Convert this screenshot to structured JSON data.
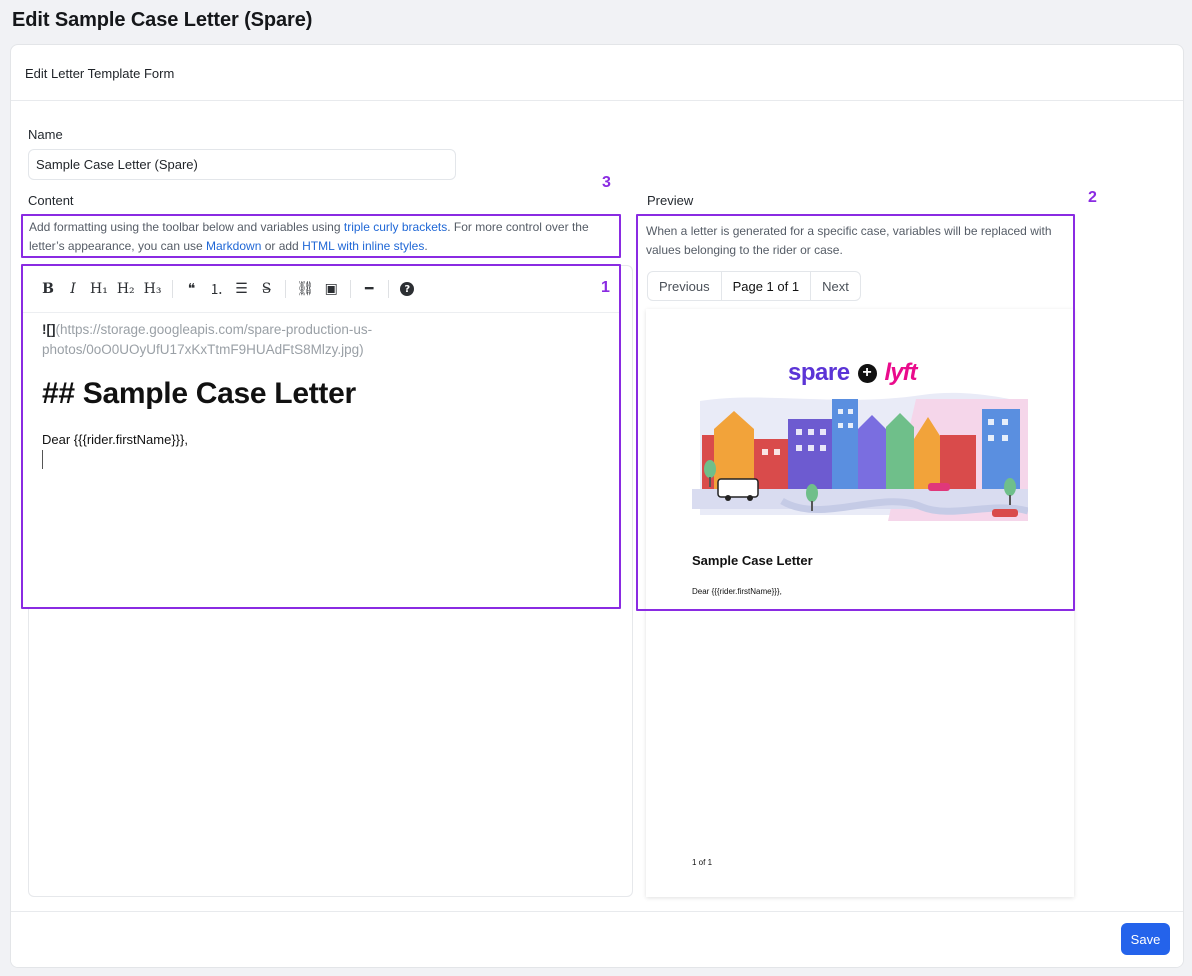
{
  "page": {
    "title": "Edit Sample Case Letter (Spare)"
  },
  "form": {
    "header": "Edit Letter Template Form",
    "name_label": "Name",
    "name_value": "Sample Case Letter (Spare)",
    "content_label": "Content",
    "content_help": {
      "part1": "Add formatting using the toolbar below and variables using ",
      "link1": "triple curly brackets",
      "part2": ". For more control over the letter’s appearance, you can use ",
      "link2": "Markdown",
      "part3": "  or add ",
      "link3": "HTML with inline styles",
      "part4": "."
    },
    "preview_label": "Preview",
    "preview_help": "When a letter is generated for a specific case, variables will be replaced with values belonging to the rider or case.",
    "annotations": {
      "editor": "1",
      "preview": "2",
      "help": "3"
    },
    "toolbar": [
      {
        "name": "bold-icon",
        "glyph": "B"
      },
      {
        "name": "italic-icon",
        "glyph": "I"
      },
      {
        "name": "heading-1-icon",
        "glyph": "H₁"
      },
      {
        "name": "heading-2-icon",
        "glyph": "H₂"
      },
      {
        "name": "heading-3-icon",
        "glyph": "H₃"
      },
      {
        "name": "quote-icon",
        "glyph": "❝"
      },
      {
        "name": "ordered-list-icon",
        "glyph": "⒈"
      },
      {
        "name": "unordered-list-icon",
        "glyph": "☰"
      },
      {
        "name": "strikethrough-icon",
        "glyph": "S̶"
      },
      {
        "name": "link-icon",
        "glyph": "⛓"
      },
      {
        "name": "image-icon",
        "glyph": "▣"
      },
      {
        "name": "horizontal-rule-icon",
        "glyph": "━"
      },
      {
        "name": "help-icon",
        "glyph": "?"
      }
    ],
    "editor": {
      "image_markdown_bang": "![]",
      "image_markdown_url": "(https://storage.googleapis.com/spare-production-us-photos/0oO0UOyUfU17xKxTtmF9HUAdFtS8Mlzy.jpg)",
      "heading": "## Sample Case Letter",
      "paragraph": "Dear {{{rider.firstName}}},"
    },
    "pager": {
      "previous": "Previous",
      "info": "Page 1 of 1",
      "next": "Next"
    },
    "preview": {
      "brand_left": "spare",
      "brand_plus": "+",
      "brand_right": "lyft",
      "title": "Sample Case Letter",
      "body": "Dear {{{rider.firstName}}},",
      "footer": "1 of 1"
    },
    "save_label": "Save"
  },
  "colors": {
    "accent": "#2463eb",
    "annotation": "#8a2be2",
    "link": "#1f67d6"
  }
}
